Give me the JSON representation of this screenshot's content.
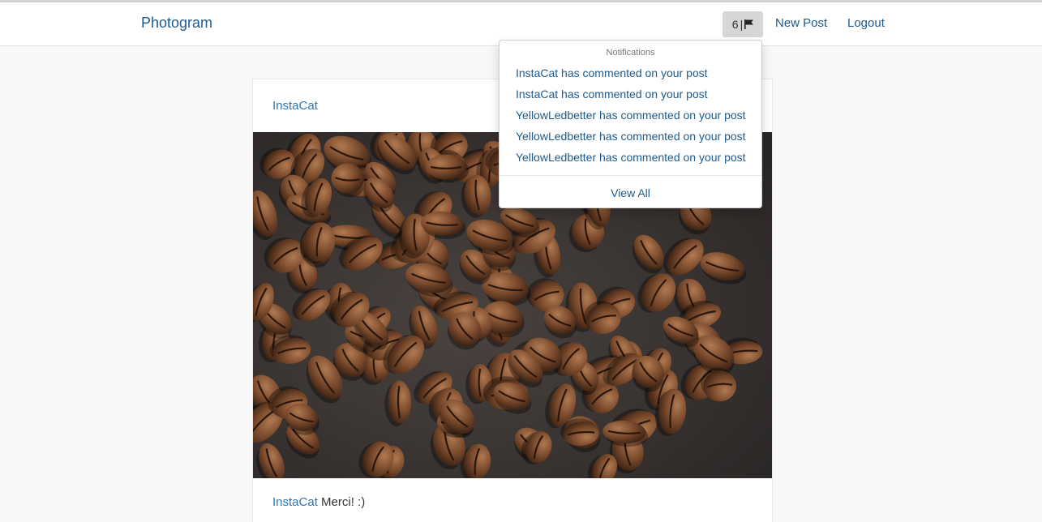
{
  "navbar": {
    "brand": "Photogram",
    "notifications_count": "6",
    "notifications_separator": "|",
    "new_post": "New Post",
    "logout": "Logout"
  },
  "dropdown": {
    "header": "Notifications",
    "items": [
      "InstaCat has commented on your post",
      "InstaCat has commented on your post",
      "YellowLedbetter has commented on your post",
      "YellowLedbetter has commented on your post",
      "YellowLedbetter has commented on your post"
    ],
    "view_all": "View All"
  },
  "post": {
    "author": "InstaCat",
    "image_icon": "coffee-beans-photo",
    "comment": {
      "author": "InstaCat",
      "text": "Merci! :)"
    }
  },
  "colors": {
    "link": "#1f5a8a",
    "author_link": "#2f77b3",
    "page_bg": "#f8f8f8",
    "notif_button_bg": "#d6d6d6"
  }
}
